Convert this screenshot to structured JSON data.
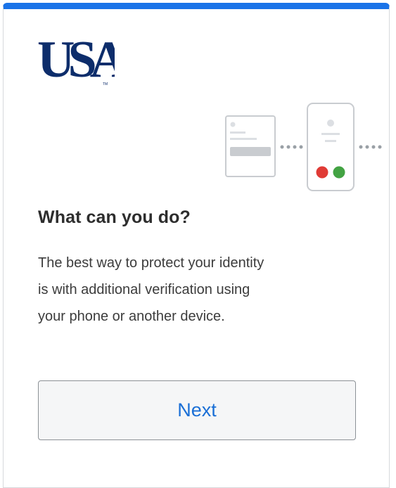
{
  "brand": {
    "logo_text": "USA",
    "accent_color": "#1a73e8",
    "logo_color": "#0d2d6b"
  },
  "content": {
    "heading": "What can you do?",
    "description_lines": [
      "The best way to protect your identity",
      "is with additional verification using",
      "your phone or another device."
    ]
  },
  "actions": {
    "next_label": "Next"
  },
  "illustration": {
    "icons": [
      "browser-window-icon",
      "phone-icon"
    ],
    "status_colors": [
      "#e03b36",
      "#43a343"
    ]
  }
}
